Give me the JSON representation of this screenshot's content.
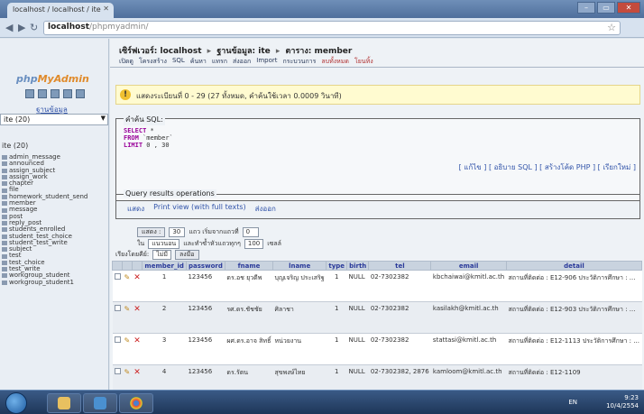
{
  "browser": {
    "tab_title": "localhost / localhost / ite",
    "url_host": "localhost",
    "url_path": "/phpmyadmin/"
  },
  "left": {
    "logo_left": "php",
    "logo_right": "MyAdmin",
    "db_label": "ฐานข้อมูล",
    "db_selected": "ite (20)",
    "db_name": "ite (20)",
    "tables": [
      "admin_message",
      "announced",
      "assign_subject",
      "assign_work",
      "chapter",
      "file",
      "homework_student_send",
      "member",
      "message",
      "post",
      "reply_post",
      "students_enrolled",
      "student_test_choice",
      "student_test_write",
      "subject",
      "test",
      "test_choice",
      "test_write",
      "workgroup_student",
      "workgroup_student1"
    ]
  },
  "main": {
    "breadcrumb": [
      "เซิร์ฟเวอร์: localhost",
      "ฐานข้อมูล: ite",
      "ตาราง: member"
    ],
    "tabs": [
      {
        "label": "เปิดดู",
        "hot": false
      },
      {
        "label": "โครงสร้าง",
        "hot": false
      },
      {
        "label": "SQL",
        "hot": false
      },
      {
        "label": "ค้นหา",
        "hot": false
      },
      {
        "label": "แทรก",
        "hot": false
      },
      {
        "label": "ส่งออก",
        "hot": false
      },
      {
        "label": "Import",
        "hot": false
      },
      {
        "label": "กระบวนการ",
        "hot": false
      },
      {
        "label": "ลบทั้งหมด",
        "hot": true
      },
      {
        "label": "โยนทิ้ง",
        "hot": true
      }
    ],
    "notice": "แสดงระเบียนที่ 0 - 29 (27 ทั้งหมด, คำค้นใช้เวลา 0.0009 วินาที)",
    "sql_legend": "คำค้น SQL:",
    "sql_lines": [
      {
        "kw": "SELECT",
        "rest": " *"
      },
      {
        "kw": "FROM",
        "rest": " `member`"
      },
      {
        "kw": "LIMIT",
        "rest": " 0 , 30"
      }
    ],
    "sql_links": "[ แก้ไข ] [ อธิบาย SQL ] [ สร้างโค้ด PHP ] [ เรียกใหม่ ]",
    "qro_legend": "Query results operations",
    "qro_links": [
      "แสดง",
      "Print view (with full texts)",
      "ส่งออก"
    ],
    "show_label": "แสดง :",
    "show_value": "30",
    "start_row_label": "แถว เริ่มจากแถวที่",
    "start_row_value": "0",
    "mode_label": "ใน",
    "mode_value": "แนวนอน",
    "repeat_label": "และทำซ้ำหัวแถวทุกๆ",
    "repeat_value": "100",
    "repeat_suffix": "เซลล์",
    "sort_label": "เรียงโดยคีย์:",
    "sort_value": "ไม่มี",
    "go_label": "ลงมือ",
    "columns": [
      "",
      "",
      "",
      "member_id",
      "password",
      "fname",
      "lname",
      "type",
      "birth",
      "tel",
      "email",
      "detail"
    ],
    "rows": [
      {
        "member_id": "1",
        "password": "123456",
        "fname": "ดร.อช ยุวดีพ",
        "lname": "บุญเจริญ ประเสริฐ",
        "type": "1",
        "birth": "NULL",
        "tel": "02-7302382",
        "email": "kbchaiwai@kmitl.ac.th",
        "detail": "สถานที่ติดต่อ : E12-906 ประวัติการศึกษา : ..."
      },
      {
        "member_id": "2",
        "password": "123456",
        "fname": "รศ.ดร.ชัชชัย",
        "lname": "ศิลาชา",
        "type": "1",
        "birth": "NULL",
        "tel": "02-7302382",
        "email": "kasilakh@kmitl.ac.th",
        "detail": "สถานที่ติดต่อ : E12-903 ประวัติการศึกษา : ..."
      },
      {
        "member_id": "3",
        "password": "123456",
        "fname": "ผศ.ดร.อาจ สิทธิ์",
        "lname": "หน่วยงาน",
        "type": "1",
        "birth": "NULL",
        "tel": "02-7302382",
        "email": "stattasi@kmitl.ac.th",
        "detail": "สถานที่ติดต่อ : E12-1113 ประวัติการศึกษา : ..."
      },
      {
        "member_id": "4",
        "password": "123456",
        "fname": "ดร.รัตน",
        "lname": "สุขพงษ์ไทย",
        "type": "1",
        "birth": "NULL",
        "tel": "02-7302382, 2876",
        "email": "kamloom@kmitl.ac.th",
        "detail": "สถานที่ติดต่อ : E12-1109"
      }
    ]
  },
  "taskbar": {
    "lang": "EN",
    "time": "9:23",
    "date": "10/4/2554"
  }
}
